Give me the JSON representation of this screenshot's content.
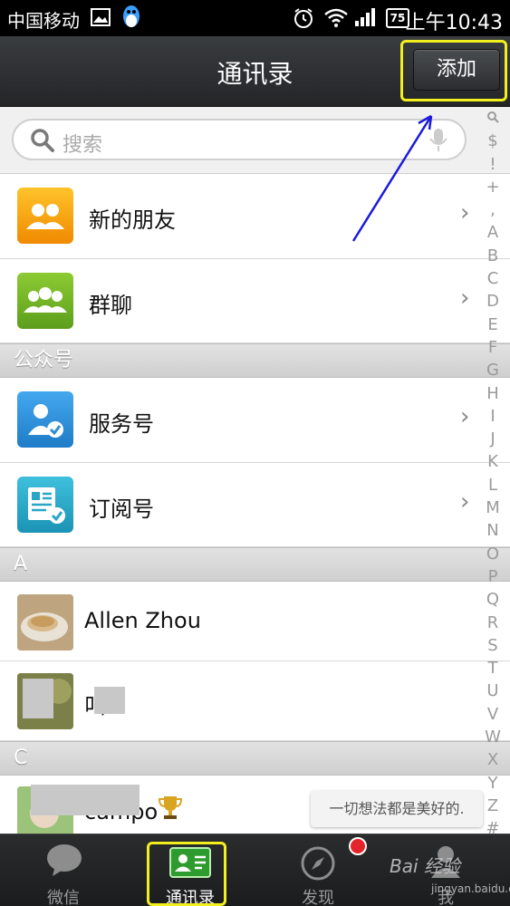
{
  "status_bar": {
    "carrier": "中国移动",
    "battery": "75",
    "time": "上午10:43"
  },
  "header": {
    "title": "通讯录",
    "add_button": "添加"
  },
  "search": {
    "placeholder": "搜索"
  },
  "rows": {
    "new_friends": "新的朋友",
    "group_chat": "群聊",
    "service": "服务号",
    "subscription": "订阅号"
  },
  "sections": {
    "official": "公众号",
    "a": "A",
    "c": "C"
  },
  "contacts": {
    "allen": "Allen Zhou",
    "second": "叫  ",
    "third": "campo"
  },
  "index_letters": [
    "Q",
    "$",
    "!",
    "+",
    ",",
    "A",
    "B",
    "C",
    "D",
    "E",
    "F",
    "G",
    "H",
    "I",
    "J",
    "K",
    "L",
    "M",
    "N",
    "O",
    "P",
    "Q",
    "R",
    "S",
    "T",
    "U",
    "V",
    "W",
    "X",
    "Y",
    "Z",
    "#"
  ],
  "toast": "一切想法都是美好的.",
  "tabs": {
    "chats": "微信",
    "contacts": "通讯录",
    "discover": "发现",
    "me": "我"
  },
  "watermark": {
    "brand": "Bai 经验",
    "url": "jingyan.baidu.com"
  },
  "colors": {
    "highlight": "#f2ef1e",
    "arrow": "#1a1adc",
    "new_friends_icon": "#f4a300",
    "group_icon": "#78b22a",
    "service_icon": "#2b8fd8",
    "subscription_icon": "#27a6c8"
  }
}
